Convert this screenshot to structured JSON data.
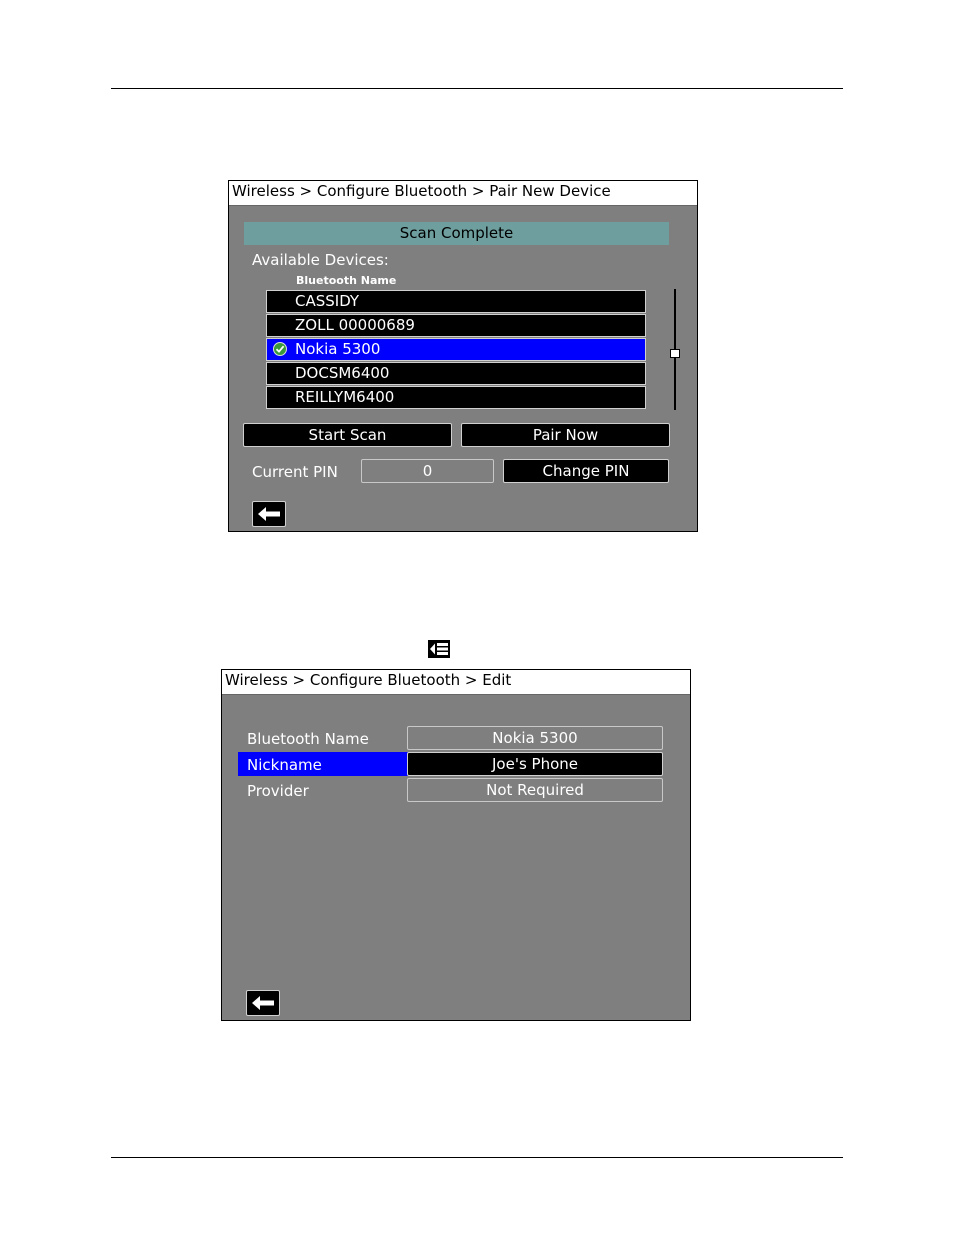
{
  "screen1": {
    "breadcrumb": "Wireless > Configure Bluetooth > Pair New Device",
    "status": "Scan Complete",
    "available_label": "Available Devices:",
    "column_header": "Bluetooth Name",
    "devices": [
      {
        "name": "CASSIDY",
        "selected": false
      },
      {
        "name": "ZOLL 00000689",
        "selected": false
      },
      {
        "name": "Nokia 5300",
        "selected": true
      },
      {
        "name": "DOCSM6400",
        "selected": false
      },
      {
        "name": "REILLYM6400",
        "selected": false
      }
    ],
    "start_scan_label": "Start Scan",
    "pair_now_label": "Pair Now",
    "current_pin_label": "Current PIN",
    "current_pin_value": "0",
    "change_pin_label": "Change PIN",
    "back_icon": "back-arrow-icon"
  },
  "screen2": {
    "breadcrumb": "Wireless > Configure Bluetooth > Edit",
    "rows": [
      {
        "label": "Bluetooth Name",
        "value": "Nokia 5300",
        "selected": false
      },
      {
        "label": "Nickname",
        "value": "Joe's Phone",
        "selected": true
      },
      {
        "label": "Provider",
        "value": "Not Required",
        "selected": false
      }
    ],
    "back_icon": "back-arrow-icon"
  },
  "inline_icon": "menu-back-icon",
  "colors": {
    "screen_bg": "#7f7f7f",
    "status_bar": "#6e9e9e",
    "selection": "#0000ff",
    "checkmark": "#3a9a3a"
  }
}
